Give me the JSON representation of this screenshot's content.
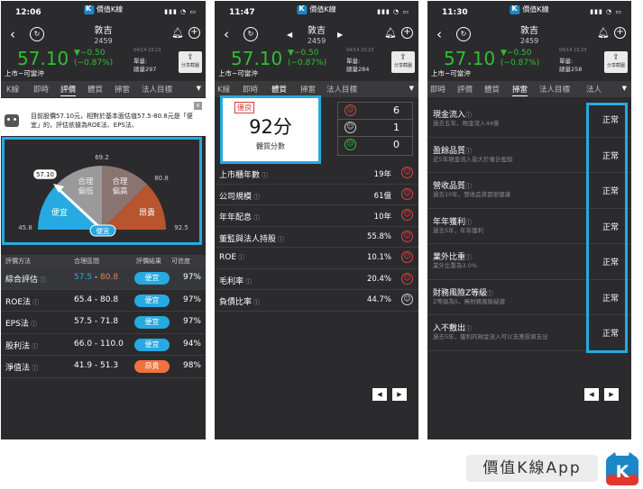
{
  "brand": "價值K線",
  "app_badge": "價值K線App",
  "stock": {
    "name": "敦吉",
    "code": "2459",
    "price": "57.10",
    "change": "▼−0.50",
    "change_pct": "(−0.87%)",
    "market": "上市−可當沖",
    "date": "04/14 23:23",
    "share_label": "分享截圖",
    "unit_label": "單量:"
  },
  "phones": [
    {
      "time": "12:06",
      "volume": "總量297",
      "tabs": [
        "K線",
        "即時",
        "評價",
        "體質",
        "掃雷",
        "法人目標"
      ],
      "active_tab": 2
    },
    {
      "time": "11:47",
      "volume": "總量284",
      "tabs": [
        "K線",
        "即時",
        "體質",
        "掃雷",
        "法人目標"
      ],
      "active_tab": 2
    },
    {
      "time": "11:30",
      "volume": "總量258",
      "tabs": [
        "即時",
        "評價",
        "體質",
        "掃雷",
        "法人目標",
        "法人"
      ],
      "active_tab": 3
    }
  ],
  "valuation": {
    "info_text": "目前股價57.10元，相對於基本面估值57.5-80.8元是「便宜」的，評估依據為ROE法、EPS法、",
    "gauge": {
      "current": "57.10",
      "min": "45.8",
      "b1": "69.2",
      "b2": "80.8",
      "max": "92.5",
      "zones": [
        "便宜",
        "合理偏低",
        "合理偏高",
        "昂貴"
      ],
      "verdict": "便宜",
      "colors": {
        "cheap": "#27a9e1",
        "fair_low": "#9a9a9a",
        "fair_high": "#8a7470",
        "expensive": "#b8542e"
      }
    },
    "headers": {
      "method": "評價方法",
      "range": "合理區間",
      "result": "評價結果",
      "confidence": "可信度"
    },
    "rows": [
      {
        "method": "綜合評估",
        "lo": "57.5",
        "sep": " - ",
        "hi": "80.8",
        "result": "便宜",
        "pct": "97%",
        "color": "#27a9e1"
      },
      {
        "method": "ROE法",
        "lo": "65.4",
        "sep": " - ",
        "hi": "80.8",
        "result": "便宜",
        "pct": "97%",
        "color": "#27a9e1"
      },
      {
        "method": "EPS法",
        "lo": "57.5",
        "sep": " - ",
        "hi": "71.8",
        "result": "便宜",
        "pct": "97%",
        "color": "#27a9e1"
      },
      {
        "method": "股利法",
        "lo": "66.0",
        "sep": " - ",
        "hi": "110.0",
        "result": "便宜",
        "pct": "94%",
        "color": "#27a9e1"
      },
      {
        "method": "淨值法",
        "lo": "41.9",
        "sep": " - ",
        "hi": "51.3",
        "result": "昂貴",
        "pct": "98%",
        "color": "#f0733f"
      }
    ]
  },
  "health": {
    "tag": "優良",
    "score": "92分",
    "score_label": "體質分數",
    "counts": [
      {
        "face": "☺",
        "num": "6"
      },
      {
        "face": "☺",
        "num": "1"
      },
      {
        "face": "☹",
        "num": "0"
      }
    ],
    "rows": [
      {
        "name": "上市櫃年數",
        "value": "19年"
      },
      {
        "name": "公司規模",
        "value": "61億"
      },
      {
        "name": "年年配息",
        "value": "10年"
      },
      {
        "name": "董監與法人持股",
        "value": "55.8%"
      },
      {
        "name": "ROE",
        "value": "10.1%"
      },
      {
        "name": "毛利率",
        "value": "20.4%"
      },
      {
        "name": "負債比率",
        "value": "44.7%"
      }
    ]
  },
  "risk": {
    "rows": [
      {
        "name": "現金流入",
        "desc": "過去五年，現金流入44億",
        "status": "正常"
      },
      {
        "name": "盈餘品質",
        "desc": "近5年現金流入皆大於會計盈餘",
        "status": "正常"
      },
      {
        "name": "營收品質",
        "desc": "過去10年，營收品質都很健康",
        "status": "正常"
      },
      {
        "name": "年年獲利",
        "desc": "過去5年，年年獲利",
        "status": "正常"
      },
      {
        "name": "業外比重",
        "desc": "業外比重為3.0%",
        "status": "正常"
      },
      {
        "name": "財務風險Z等級",
        "desc": "Z等級為5，無財務風險疑慮",
        "status": "正常"
      },
      {
        "name": "入不敷出",
        "desc": "過去5年，獲利的現金流入可以支應投資支出",
        "status": "正常"
      }
    ]
  },
  "pager": {
    "prev": "◀",
    "next": "▶"
  }
}
